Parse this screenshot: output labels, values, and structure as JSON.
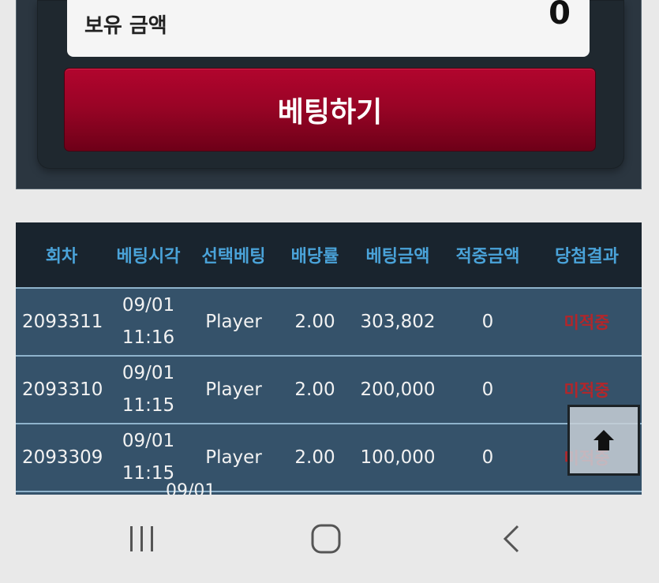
{
  "balance": {
    "label": "보유 금액",
    "value": "0"
  },
  "bet_button": {
    "label": "베팅하기"
  },
  "table": {
    "headers": [
      "회차",
      "베팅시각",
      "선택베팅",
      "배당률",
      "베팅금액",
      "적중금액",
      "당첨결과"
    ],
    "rows": [
      {
        "round": "2093311",
        "date": "09/01",
        "time": "11:16",
        "choice": "Player",
        "odds": "2.00",
        "amount": "303,802",
        "win": "0",
        "result": "미적중"
      },
      {
        "round": "2093310",
        "date": "09/01",
        "time": "11:15",
        "choice": "Player",
        "odds": "2.00",
        "amount": "200,000",
        "win": "0",
        "result": "미적중"
      },
      {
        "round": "2093309",
        "date": "09/01",
        "time": "11:15",
        "choice": "Player",
        "odds": "2.00",
        "amount": "100,000",
        "win": "0",
        "result": "미적중"
      }
    ],
    "partial_row_date": "09/01"
  },
  "colors": {
    "header_text": "#4aa3d9",
    "result_text": "#b3262a",
    "button": "#9a0426",
    "row_bg": "#35526a"
  },
  "icons": {
    "scroll_top": "arrow-up-icon",
    "nav_recent": "recent-apps-icon",
    "nav_home": "home-icon",
    "nav_back": "back-icon"
  }
}
